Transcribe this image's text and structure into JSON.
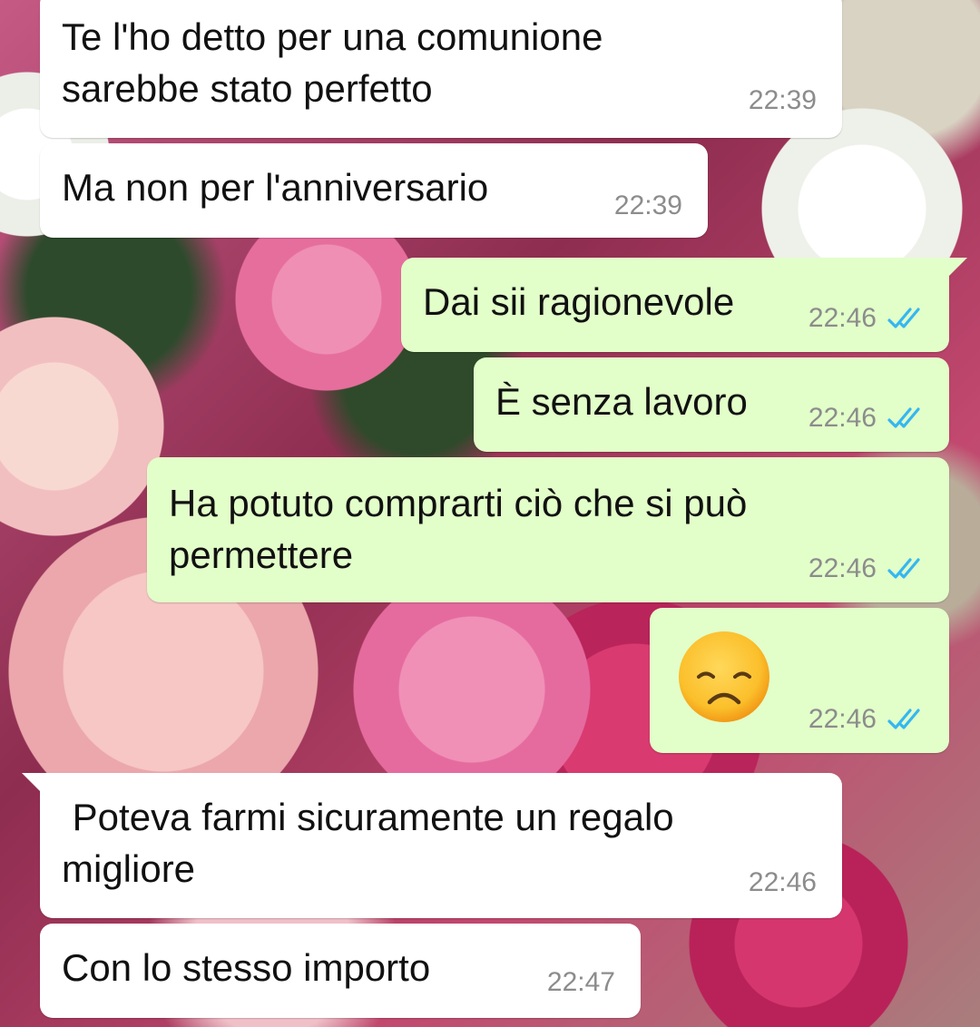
{
  "messages": [
    {
      "direction": "incoming",
      "text": "Te l'ho detto per una comunione\nsarebbe stato perfetto",
      "time": "22:39"
    },
    {
      "direction": "incoming",
      "text": "Ma non per l'anniversario",
      "time": "22:39"
    },
    {
      "direction": "outgoing",
      "text": "Dai sii ragionevole",
      "time": "22:46",
      "status": "read"
    },
    {
      "direction": "outgoing",
      "text": "È senza lavoro",
      "time": "22:46",
      "status": "read"
    },
    {
      "direction": "outgoing",
      "text": "Ha potuto comprarti ciò che si può\npermettere",
      "time": "22:46",
      "status": "read"
    },
    {
      "direction": "outgoing",
      "emoji": "disappointed-face",
      "time": "22:46",
      "status": "read"
    },
    {
      "direction": "incoming",
      "text": " Poteva farmi sicuramente un regalo\nmigliore",
      "time": "22:46"
    },
    {
      "direction": "incoming",
      "text": "Con lo stesso importo",
      "time": "22:47"
    }
  ],
  "colors": {
    "incoming_bubble": "#ffffff",
    "outgoing_bubble": "#e2fec9",
    "timestamp": "#8c8c8c",
    "read_ticks": "#34b7f1"
  },
  "icons": {
    "read_status": "double-check-icon",
    "emoji": "disappointed-face-emoji"
  }
}
